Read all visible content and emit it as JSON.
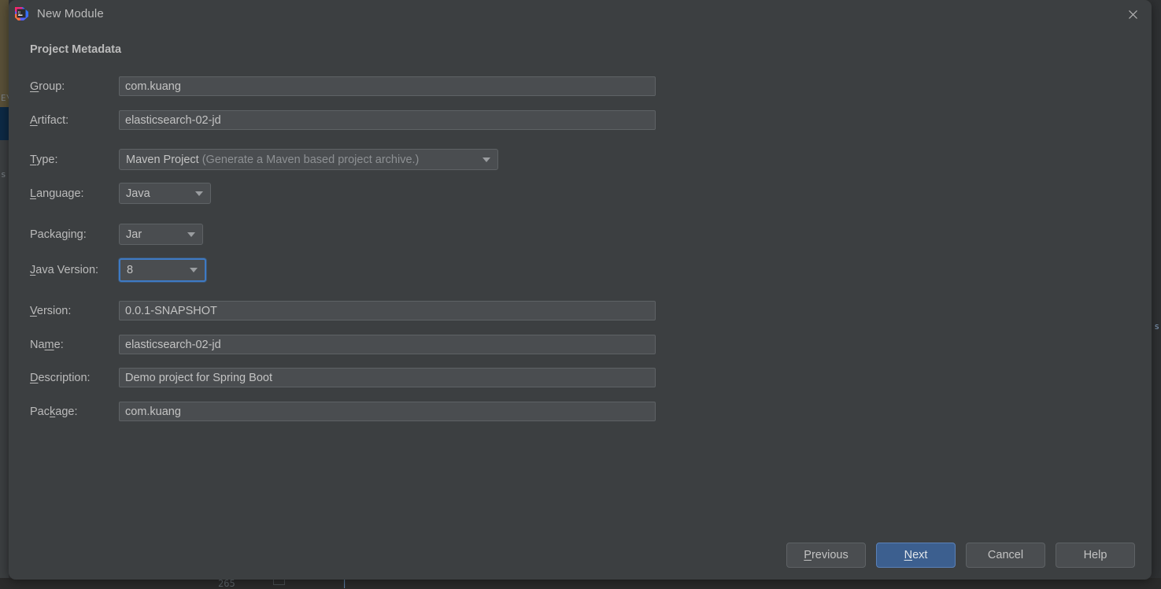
{
  "window": {
    "title": "New Module",
    "app_icon": "intellij-idea-icon",
    "close_icon": "close-icon"
  },
  "dialog": {
    "section_title": "Project Metadata",
    "fields": [
      {
        "label_pre": "",
        "label_mnemonic": "G",
        "label_post": "roup:",
        "value": "com.kuang",
        "kind": "text",
        "name": "group"
      },
      {
        "label_pre": "",
        "label_mnemonic": "A",
        "label_post": "rtifact:",
        "value": "elasticsearch-02-jd",
        "kind": "text",
        "name": "artifact"
      },
      {
        "label_pre": "",
        "label_mnemonic": "T",
        "label_post": "ype:",
        "value": "Maven Project",
        "hint": "(Generate a Maven based project archive.)",
        "kind": "combo",
        "name": "type"
      },
      {
        "label_pre": "",
        "label_mnemonic": "L",
        "label_post": "anguage:",
        "value": "Java",
        "kind": "combo",
        "name": "language"
      },
      {
        "label_pre": "Packa",
        "label_mnemonic": "g",
        "label_post": "ing:",
        "value": "Jar",
        "kind": "combo",
        "name": "packaging"
      },
      {
        "label_pre": "",
        "label_mnemonic": "J",
        "label_post": "ava Version:",
        "value": "8",
        "kind": "combo",
        "focused": true,
        "name": "java-version"
      },
      {
        "label_pre": "",
        "label_mnemonic": "V",
        "label_post": "ersion:",
        "value": "0.0.1-SNAPSHOT",
        "kind": "text",
        "name": "version"
      },
      {
        "label_pre": "Na",
        "label_mnemonic": "m",
        "label_post": "e:",
        "value": "elasticsearch-02-jd",
        "kind": "text",
        "name": "name"
      },
      {
        "label_pre": "",
        "label_mnemonic": "D",
        "label_post": "escription:",
        "value": "Demo project for Spring Boot",
        "kind": "text",
        "name": "description"
      },
      {
        "label_pre": "Pac",
        "label_mnemonic": "k",
        "label_post": "age:",
        "value": "com.kuang",
        "kind": "text",
        "name": "package"
      }
    ],
    "buttons": [
      {
        "pre": "",
        "mnemonic": "P",
        "post": "revious",
        "primary": false,
        "name": "previous-button"
      },
      {
        "pre": "",
        "mnemonic": "N",
        "post": "ext",
        "primary": true,
        "name": "next-button"
      },
      {
        "pre": "Cancel",
        "mnemonic": "",
        "post": "",
        "primary": false,
        "name": "cancel-button"
      },
      {
        "pre": "Help",
        "mnemonic": "",
        "post": "",
        "primary": false,
        "name": "help-button"
      }
    ]
  },
  "backdrop": {
    "gutter_char": "s",
    "editor_char": "E\\",
    "right_char": "s",
    "bottom_number": "265",
    "bottom_caret": "|"
  },
  "colors": {
    "dialog_bg": "#3c3f41",
    "input_bg": "#4a4d50",
    "text": "#bbbbbb",
    "accent_focus": "#3e7ac4",
    "primary_button": "#3c5f8f"
  }
}
